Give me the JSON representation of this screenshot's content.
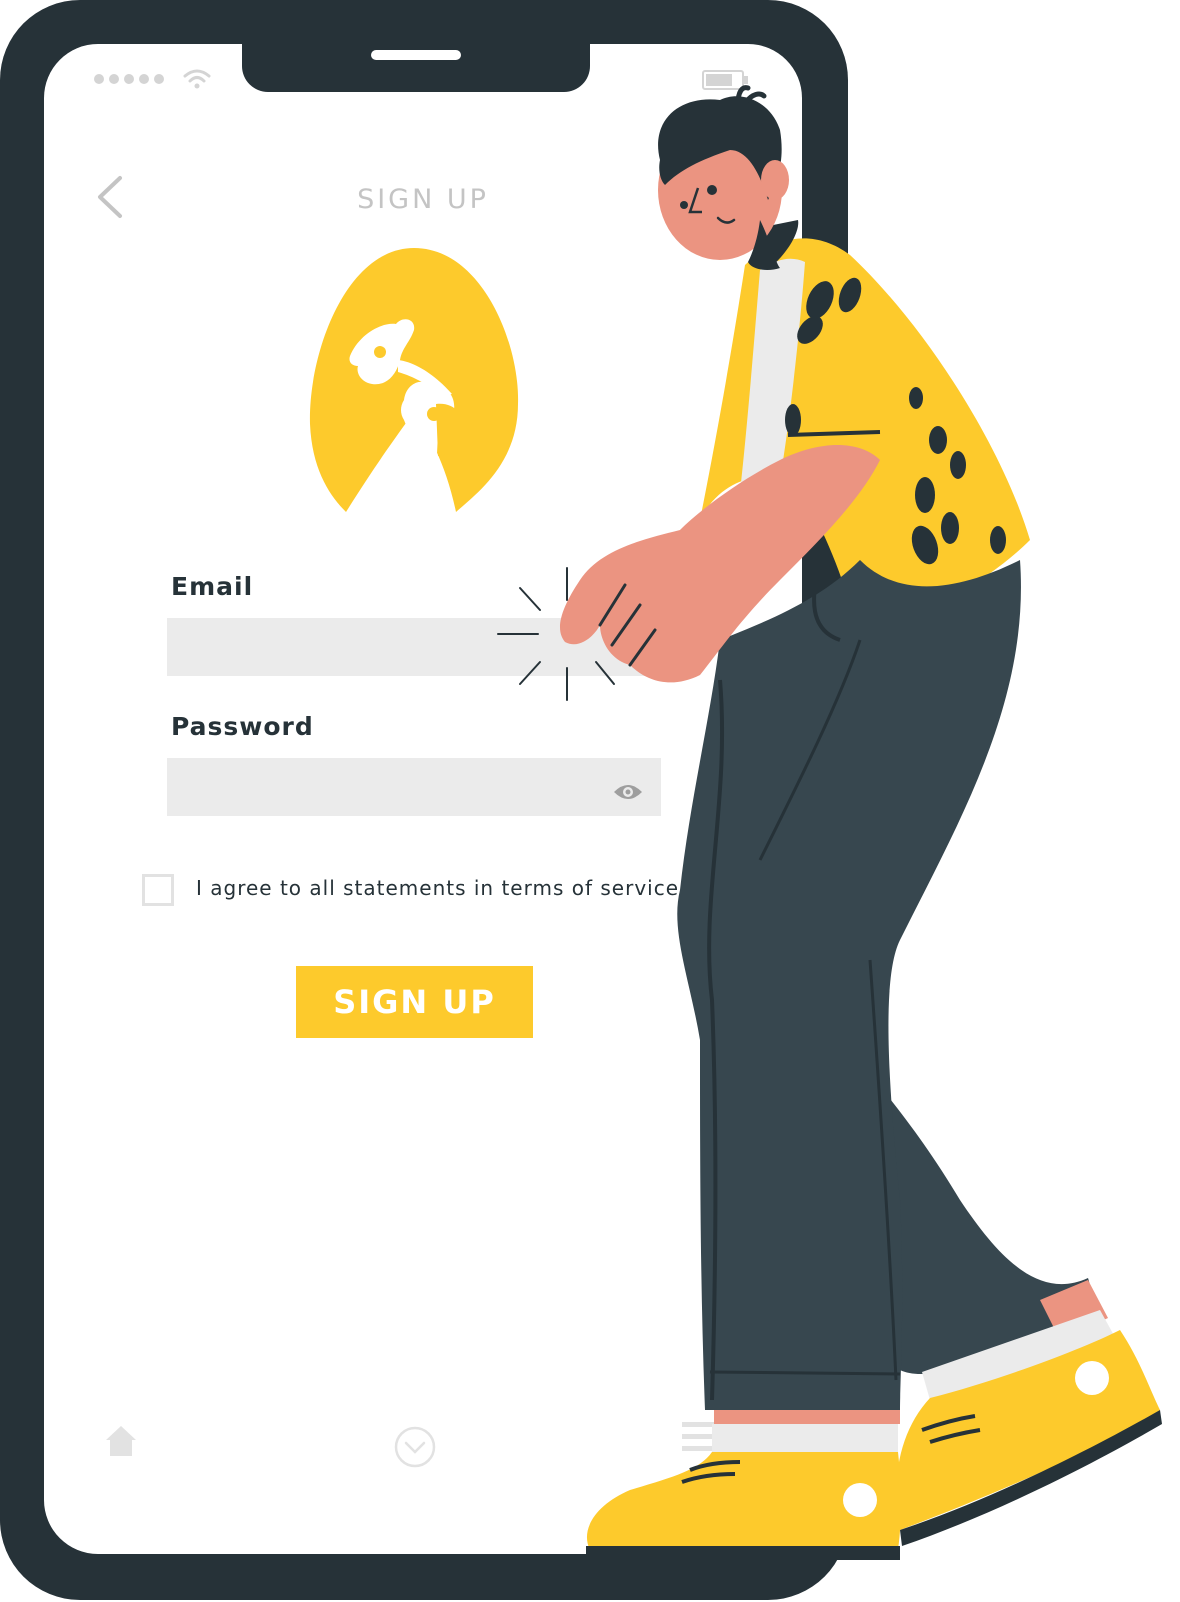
{
  "signup": {
    "title": "SIGN UP",
    "email_label": "Email",
    "email_value": "",
    "password_label": "Password",
    "password_value": "",
    "terms_text": "I agree to all statements in terms of service",
    "terms_checked": false,
    "button_label": "SIGN UP"
  },
  "icons": {
    "back": "chevron-left",
    "password_toggle": "eye",
    "status": [
      "signal-dots",
      "wifi",
      "battery"
    ],
    "nav": [
      "home",
      "chevron-down-circle",
      "menu"
    ]
  },
  "colors": {
    "accent": "#fdca2c",
    "dark": "#263238",
    "field": "#ebebeb",
    "muted": "#c4c4c4",
    "skin": "#eb9481",
    "pants": "#37474f"
  }
}
